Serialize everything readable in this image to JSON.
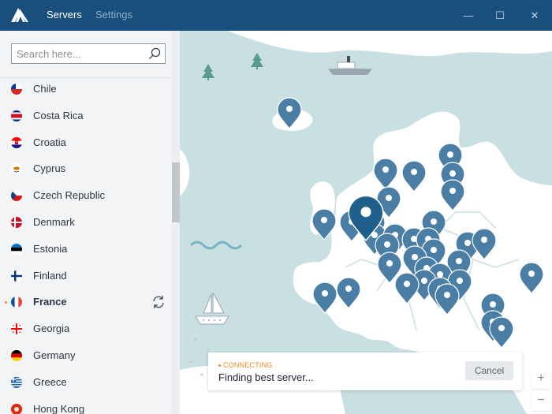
{
  "titlebar": {
    "tabs": [
      {
        "label": "Servers",
        "active": true
      },
      {
        "label": "Settings",
        "active": false
      }
    ],
    "controls": {
      "minimize": "—",
      "maximize": "☐",
      "close": "✕"
    },
    "bg_color": "#194f7d"
  },
  "search": {
    "placeholder": "Search here...",
    "value": "",
    "icon": "search-icon"
  },
  "countries": [
    {
      "name": "Chile",
      "flag": "chile"
    },
    {
      "name": "Costa Rica",
      "flag": "costa-rica"
    },
    {
      "name": "Croatia",
      "flag": "croatia"
    },
    {
      "name": "Cyprus",
      "flag": "cyprus"
    },
    {
      "name": "Czech Republic",
      "flag": "czech-republic"
    },
    {
      "name": "Denmark",
      "flag": "denmark"
    },
    {
      "name": "Estonia",
      "flag": "estonia"
    },
    {
      "name": "Finland",
      "flag": "finland"
    },
    {
      "name": "France",
      "flag": "france",
      "active": true
    },
    {
      "name": "Georgia",
      "flag": "georgia"
    },
    {
      "name": "Germany",
      "flag": "germany"
    },
    {
      "name": "Greece",
      "flag": "greece"
    },
    {
      "name": "Hong Kong",
      "flag": "hong-kong"
    }
  ],
  "connection": {
    "status": "CONNECTING",
    "message": "Finding best server...",
    "cancel_label": "Cancel",
    "status_color": "#f08a24"
  },
  "zoom": {
    "in_label": "+",
    "out_label": "−"
  },
  "map": {
    "pin_color": "#4a7ea5",
    "active_pin_color": "#1f5f8b",
    "land_color": "#ffffff",
    "water_color": "#c9e0e2"
  }
}
